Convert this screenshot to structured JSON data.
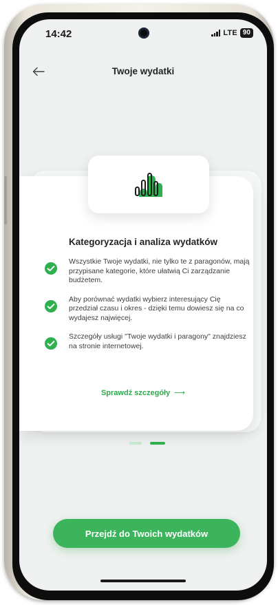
{
  "status_bar": {
    "time": "14:42",
    "network": "LTE",
    "battery": "90"
  },
  "header": {
    "title": "Twoje wydatki",
    "back_icon": "arrow-left-icon"
  },
  "card": {
    "icon": "bar-chart-icon",
    "heading": "Kategoryzacja i analiza wydatków",
    "features": [
      {
        "icon": "check-circle-icon",
        "text": "Wszystkie Twoje wydatki, nie tylko te z paragonów, mają przypisane kategorie, które ułatwią Ci zarządzanie budżetem."
      },
      {
        "icon": "check-circle-icon",
        "text": "Aby porównać wydatki wybierz interesujący Cię przedział czasu i okres - dzięki temu dowiesz się na co wydajesz najwięcej."
      },
      {
        "icon": "check-circle-icon",
        "text": "Szczegóły usługi \"Twoje wydatki i paragony\" znajdziesz na stronie internetowej."
      }
    ],
    "details_link": "Sprawdź szczegóły",
    "details_arrow": "⟶"
  },
  "pagination": {
    "total": 2,
    "active": 2
  },
  "cta": {
    "label": "Przejdź do Twoich wydatków"
  },
  "colors": {
    "accent": "#3cb45b",
    "accent_dark": "#2fab4d",
    "accent_light": "#c3e8cd",
    "screen_bg": "#eef1ef"
  }
}
